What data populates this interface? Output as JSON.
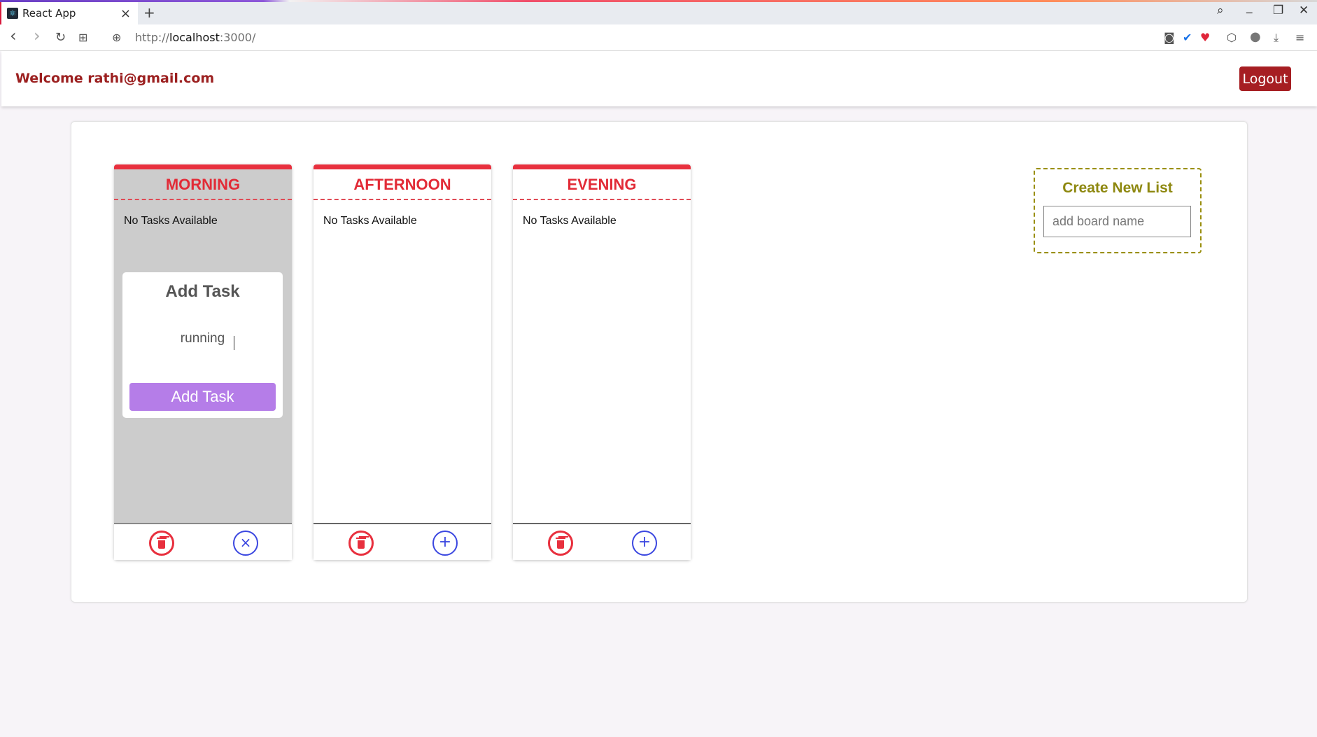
{
  "browser": {
    "tab_title": "React App",
    "tab_favicon": "react-logo-icon",
    "tab_close": "×",
    "new_tab": "+",
    "url_prefix": "http://",
    "url_host": "localhost",
    "url_port": ":3000/",
    "controls": {
      "search": "⌕",
      "minimize": "_",
      "restore": "❐",
      "close": "✕"
    },
    "nav": {
      "back": "‹",
      "forward": "›",
      "reload": "↻",
      "apps": "⊞",
      "site_info": "⊕"
    },
    "extensions": [
      "camera-icon",
      "shield-icon",
      "heart-icon",
      "cube-icon",
      "profile-icon",
      "download-icon",
      "menu-icon"
    ],
    "extension_glyphs": [
      "◙",
      "✔",
      "♥",
      "⬡",
      "●",
      "⤓",
      "≡"
    ]
  },
  "header": {
    "welcome_text": "Welcome rathi@gmail.com",
    "logout_label": "Logout",
    "welcome_color": "#9c2020",
    "logout_color": "#a61e22"
  },
  "lists": [
    {
      "title": "MORNING",
      "empty_text": "No Tasks Available",
      "right_action": "close"
    },
    {
      "title": "AFTERNOON",
      "empty_text": "No Tasks Available",
      "right_action": "add"
    },
    {
      "title": "EVENING",
      "empty_text": "No Tasks Available",
      "right_action": "add"
    }
  ],
  "add_task": {
    "title": "Add Task",
    "input_value": "running",
    "button_label": "Add Task",
    "button_color": "#b57de8"
  },
  "create_list": {
    "title": "Create New List",
    "placeholder": "add board name"
  },
  "glyphs": {
    "plus": "+",
    "close": "×"
  },
  "colors": {
    "list_accent": "#e8303e",
    "action_blue": "#3b47e0",
    "create_border": "#9a8f0f"
  }
}
